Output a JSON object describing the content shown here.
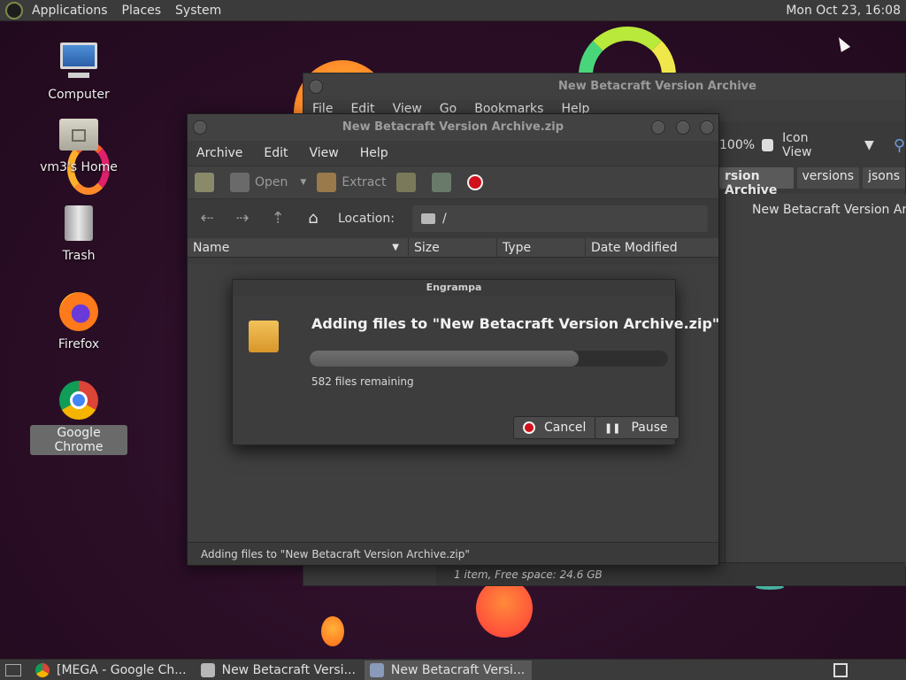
{
  "top_panel": {
    "menus": [
      "Applications",
      "Places",
      "System"
    ],
    "clock": "Mon Oct 23, 16:08"
  },
  "desktop_icons": [
    {
      "label": "Computer",
      "icon": "computer-icon"
    },
    {
      "label": "vm3's Home",
      "icon": "home-folder-icon"
    },
    {
      "label": "Trash",
      "icon": "trash-icon"
    },
    {
      "label": "Firefox",
      "icon": "firefox-icon"
    },
    {
      "label": "Google Chrome",
      "icon": "chrome-icon",
      "selected": true
    }
  ],
  "caja": {
    "title": "New Betacraft Version Archive",
    "menu": [
      "File",
      "Edit",
      "View",
      "Go",
      "Bookmarks",
      "Help"
    ],
    "zoom": "100%",
    "view_mode": "Icon View",
    "path": [
      "rsion Archive",
      "versions",
      "jsons"
    ],
    "item": "New Betacraft Version Archive",
    "status": "1 item, Free space: 24.6 GB"
  },
  "engrampa": {
    "title": "New Betacraft Version Archive.zip",
    "menu": [
      "Archive",
      "Edit",
      "View",
      "Help"
    ],
    "toolbar": {
      "open": "Open",
      "extract": "Extract"
    },
    "location_label": "Location:",
    "location_path": "/",
    "columns": [
      "Name",
      "Size",
      "Type",
      "Date Modified"
    ],
    "status": "Adding files to \"New Betacraft Version Archive.zip\""
  },
  "dialog": {
    "title": "Engrampa",
    "heading": "Adding files to \"New Betacraft Version Archive.zip\"",
    "progress": 0.75,
    "remaining": "582 files remaining",
    "cancel": "Cancel",
    "pause": "Pause"
  },
  "taskbar": {
    "tasks": [
      "[MEGA - Google Ch...",
      "New Betacraft Versi...",
      "New Betacraft Versi..."
    ]
  },
  "colors": {
    "accent_red": "#d0101a",
    "panel": "#3b3b3b",
    "window": "#3c3c3c"
  }
}
